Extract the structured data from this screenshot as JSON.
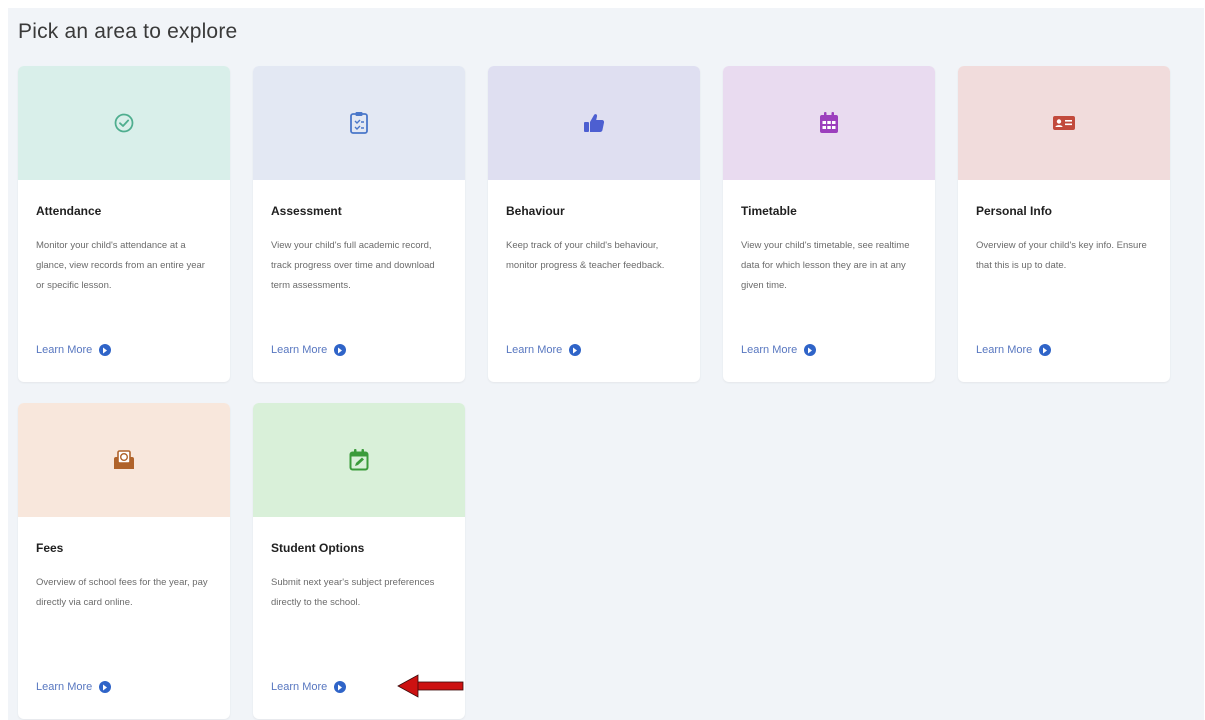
{
  "page": {
    "title": "Pick an area to explore"
  },
  "colors": {
    "attendance_bg": "#d9efea",
    "assessment_bg": "#e3e8f3",
    "behaviour_bg": "#dfdff1",
    "timetable_bg": "#e9dbf0",
    "personal_bg": "#f1dcdc",
    "fees_bg": "#f8e7dc",
    "options_bg": "#d9f0d9",
    "link": "#5877c0",
    "link_icon": "#2f64c8",
    "annotation_arrow": "#cc1111"
  },
  "cards": [
    {
      "id": "attendance",
      "icon": "check-circle-icon",
      "title": "Attendance",
      "description": "Monitor your child's attendance at a glance, view records from an entire year or specific lesson.",
      "link": "Learn More"
    },
    {
      "id": "assessment",
      "icon": "clipboard-icon",
      "title": "Assessment",
      "description": "View your child's full academic record, track progress over time and download term assessments.",
      "link": "Learn More"
    },
    {
      "id": "behaviour",
      "icon": "thumbs-up-icon",
      "title": "Behaviour",
      "description": "Keep track of your child's behaviour, monitor progress & teacher feedback.",
      "link": "Learn More"
    },
    {
      "id": "timetable",
      "icon": "calendar-icon",
      "title": "Timetable",
      "description": "View your child's timetable, see realtime data for which lesson they are in at any given time.",
      "link": "Learn More"
    },
    {
      "id": "personal-info",
      "icon": "id-card-icon",
      "title": "Personal Info",
      "description": "Overview of your child's key info. Ensure that this is up to date.",
      "link": "Learn More"
    },
    {
      "id": "fees",
      "icon": "money-envelope-icon",
      "title": "Fees",
      "description": "Overview of school fees for the year, pay directly via card online.",
      "link": "Learn More"
    },
    {
      "id": "student-options",
      "icon": "calendar-edit-icon",
      "title": "Student Options",
      "description": "Submit next year's subject preferences directly to the school.",
      "link": "Learn More"
    }
  ]
}
